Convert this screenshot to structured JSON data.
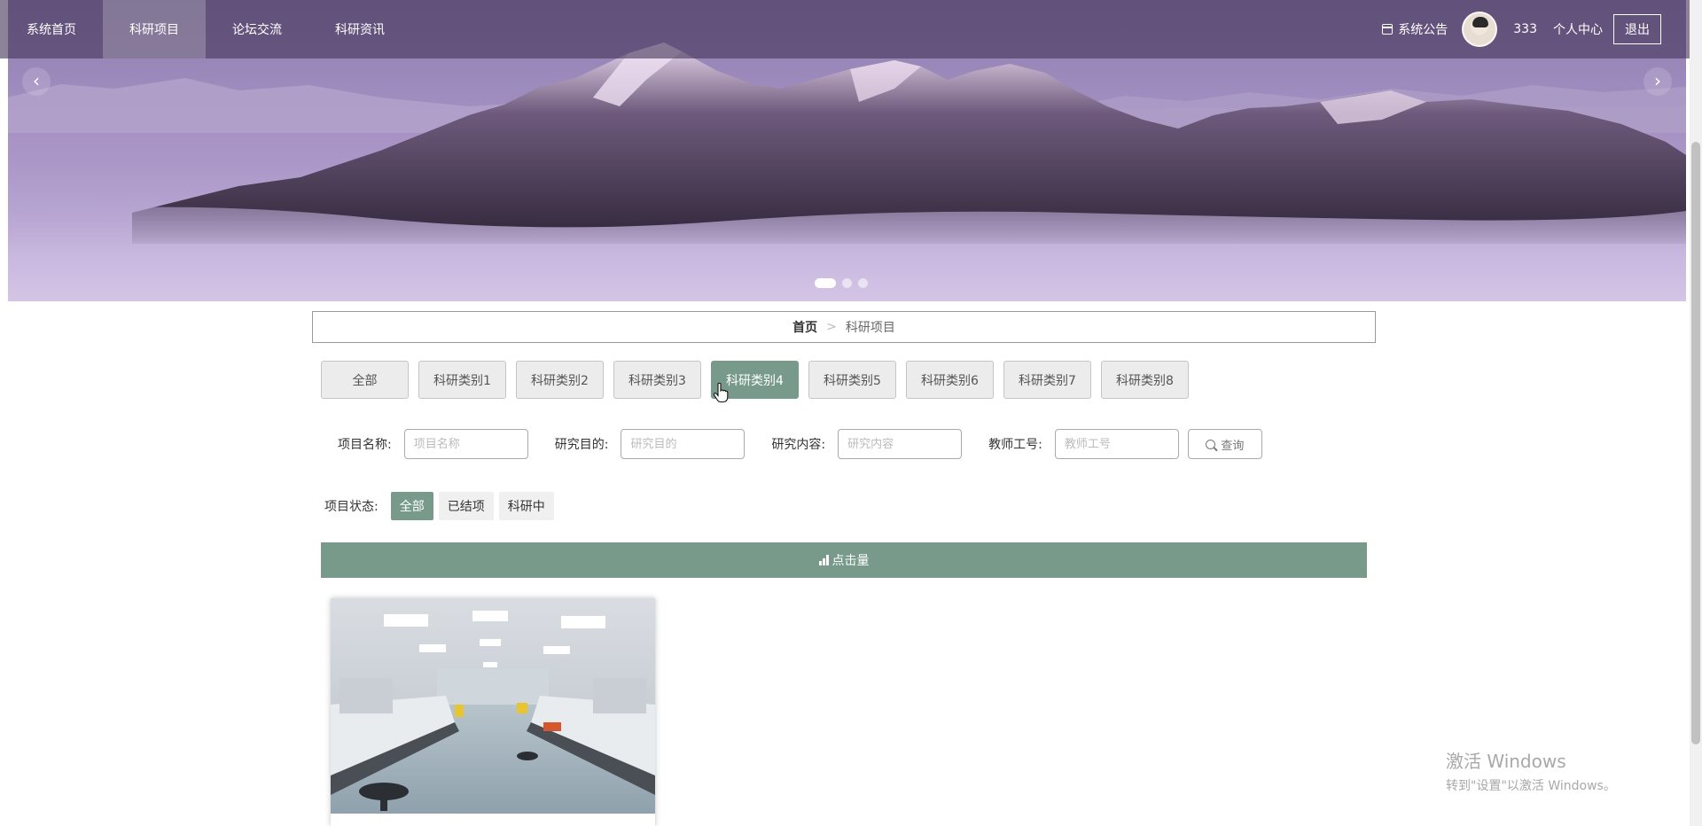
{
  "nav": {
    "items": [
      {
        "label": "系统首页"
      },
      {
        "label": "科研项目"
      },
      {
        "label": "论坛交流"
      },
      {
        "label": "科研资讯"
      }
    ],
    "active_index": 1,
    "notice_label": "系统公告",
    "username": "333",
    "personal_center": "个人中心",
    "logout": "退出"
  },
  "carousel": {
    "prev_label": "‹",
    "next_label": "›",
    "slide_count": 3,
    "active_slide": 0
  },
  "breadcrumb": {
    "home": "首页",
    "separator": ">",
    "current": "科研项目"
  },
  "categories": {
    "items": [
      "全部",
      "科研类别1",
      "科研类别2",
      "科研类别3",
      "科研类别4",
      "科研类别5",
      "科研类别6",
      "科研类别7",
      "科研类别8"
    ],
    "active_index": 4
  },
  "search": {
    "fields": [
      {
        "label": "项目名称:",
        "placeholder": "项目名称",
        "value": ""
      },
      {
        "label": "研究目的:",
        "placeholder": "研究目的",
        "value": ""
      },
      {
        "label": "研究内容:",
        "placeholder": "研究内容",
        "value": ""
      },
      {
        "label": "教师工号:",
        "placeholder": "教师工号",
        "value": ""
      }
    ],
    "query_label": "查询"
  },
  "status": {
    "label": "项目状态:",
    "options": [
      "全部",
      "已结项",
      "科研中"
    ],
    "active_index": 0
  },
  "sort": {
    "label": "点击量"
  },
  "watermark": {
    "title": "激活 Windows",
    "subtitle": "转到\"设置\"以激活 Windows。"
  },
  "colors": {
    "accent": "#779a8b",
    "nav_bg": "#46375a"
  }
}
